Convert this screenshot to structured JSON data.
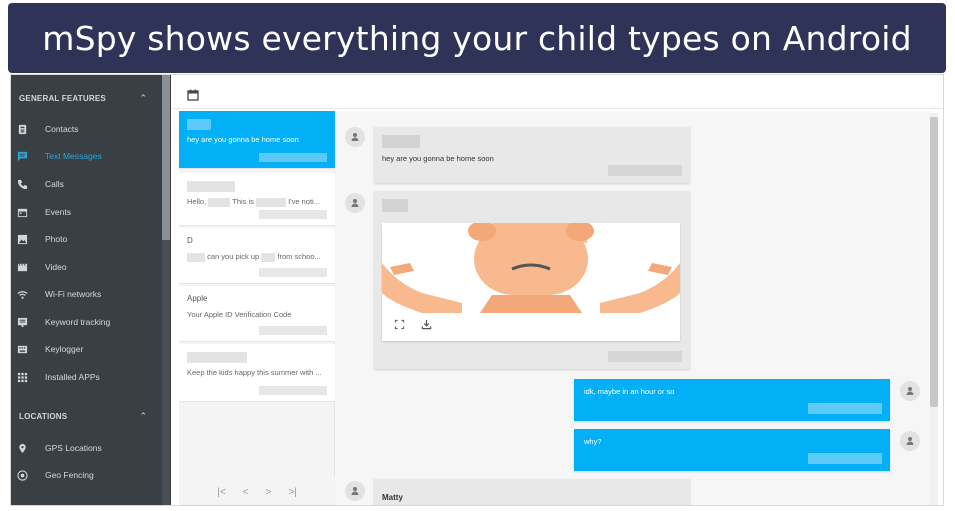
{
  "banner": {
    "title": "mSpy shows everything your child types on Android"
  },
  "sidebar": {
    "sections": [
      {
        "label": "GENERAL FEATURES"
      },
      {
        "label": "LOCATIONS"
      }
    ],
    "items": [
      {
        "label": "Contacts",
        "icon": "contacts-icon",
        "active": false
      },
      {
        "label": "Text Messages",
        "icon": "message-icon",
        "active": true
      },
      {
        "label": "Calls",
        "icon": "phone-icon",
        "active": false
      },
      {
        "label": "Events",
        "icon": "calendar-icon",
        "active": false
      },
      {
        "label": "Photo",
        "icon": "photo-icon",
        "active": false
      },
      {
        "label": "Video",
        "icon": "video-icon",
        "active": false
      },
      {
        "label": "Wi-Fi networks",
        "icon": "wifi-icon",
        "active": false
      },
      {
        "label": "Keyword tracking",
        "icon": "keyword-icon",
        "active": false
      },
      {
        "label": "Keylogger",
        "icon": "keyboard-icon",
        "active": false
      },
      {
        "label": "Installed APPs",
        "icon": "apps-icon",
        "active": false
      }
    ],
    "location_items": [
      {
        "label": "GPS Locations",
        "icon": "location-pin-icon"
      },
      {
        "label": "Geo Fencing",
        "icon": "geofence-icon"
      }
    ],
    "accent_color": "#28a6dc"
  },
  "conversations": [
    {
      "name": "",
      "snippet": "hey are you gonna be home soon",
      "active": true
    },
    {
      "name": "",
      "snippet_parts": [
        "Hello,",
        "This is",
        "I've noti..."
      ],
      "active": false
    },
    {
      "name": "D",
      "snippet_parts": [
        "",
        "can you pick up",
        "from schoo..."
      ],
      "active": false
    },
    {
      "name": "Apple",
      "snippet": "Your Apple ID Verification Code",
      "active": false
    },
    {
      "name": "",
      "snippet": "Keep the kids happy this summer with ...",
      "active": false
    }
  ],
  "pager": {
    "first": "|<",
    "prev": "<",
    "next": ">",
    "last": ">|"
  },
  "thread": {
    "messages": [
      {
        "direction": "in",
        "text": "hey are you gonna be home soon"
      },
      {
        "direction": "in",
        "type": "image"
      },
      {
        "direction": "out",
        "text": "idk, maybe in an hour or so"
      },
      {
        "direction": "out",
        "text": "why?"
      },
      {
        "direction": "in",
        "sender": "Matty"
      }
    ]
  },
  "colors": {
    "banner": "#2f3357",
    "sidebar": "#3a3f44",
    "bubble_out": "#03b0f6",
    "bubble_in": "#e8e8e8"
  }
}
